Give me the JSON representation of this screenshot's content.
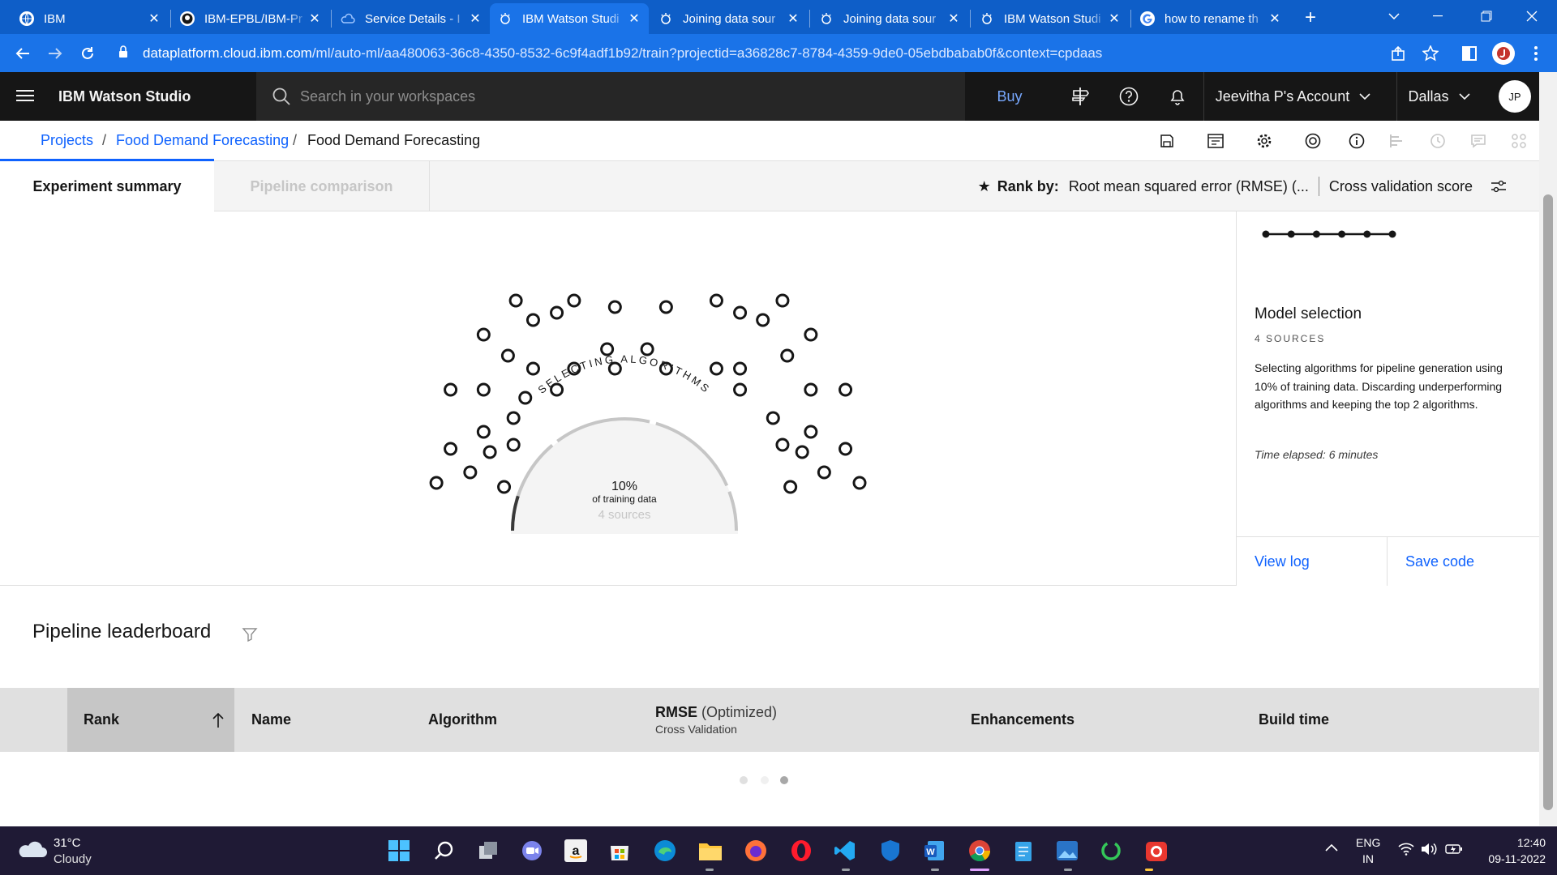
{
  "browser": {
    "tabs": [
      {
        "title": "IBM",
        "favicon": "globe-icon",
        "favicon_bg": "#ffffff"
      },
      {
        "title": "IBM-EPBL/IBM-Pr",
        "favicon": "github-icon",
        "favicon_bg": "#ffffff"
      },
      {
        "title": "Service Details - I",
        "favicon": "ibm-cloud-icon",
        "favicon_bg": "#0e5ec8"
      },
      {
        "title": "IBM Watson Studi",
        "favicon": "watson-icon",
        "favicon_bg": "#1a73e8"
      },
      {
        "title": "Joining data sour",
        "favicon": "watson-icon",
        "favicon_bg": "#0e5ec8"
      },
      {
        "title": "Joining data sour",
        "favicon": "watson-icon",
        "favicon_bg": "#0e5ec8"
      },
      {
        "title": "IBM Watson Studi",
        "favicon": "watson-icon",
        "favicon_bg": "#0e5ec8"
      },
      {
        "title": "how to rename th",
        "favicon": "google-icon",
        "favicon_bg": "#ffffff"
      }
    ],
    "new_tab": "+",
    "url_host": "dataplatform.cloud.ibm.com",
    "url_path": "/ml/auto-ml/aa480063-36c8-4350-8532-6c9f4adf1b92/train?projectid=a36828c7-8784-4359-9de0-05ebdbabab0f&context=cpdaas"
  },
  "header": {
    "app_name": "IBM Watson Studio",
    "search_placeholder": "Search in your workspaces",
    "buy": "Buy",
    "account": "Jeevitha P's Account",
    "region": "Dallas",
    "avatar_initials": "JP"
  },
  "breadcrumb": {
    "projects": "Projects",
    "project": "Food Demand Forecasting",
    "current": "Food Demand Forecasting",
    "separator": "/"
  },
  "tabs": {
    "summary": "Experiment summary",
    "comparison": "Pipeline comparison"
  },
  "rank": {
    "label": "Rank by:",
    "metric": "Root mean squared error (RMSE) (...",
    "score": "Cross validation score"
  },
  "progress": {
    "arc_label": "SELECTING ALGORITHMS",
    "percent": "10%",
    "percent_label": "of training data",
    "sources": "4 sources",
    "fill_fraction": 0.1
  },
  "stage_panel": {
    "title": "Model selection",
    "count": "4 SOURCES",
    "description": "Selecting algorithms for pipeline generation using 10% of training data. Discarding underperforming algorithms and keeping the top 2 algorithms.",
    "elapsed": "Time elapsed: 6 minutes",
    "view_log": "View log",
    "save_code": "Save code",
    "steps_total": 6
  },
  "leaderboard": {
    "title": "Pipeline leaderboard",
    "columns": {
      "rank": "Rank",
      "name": "Name",
      "algorithm": "Algorithm",
      "rmse": "RMSE",
      "rmse_suffix": "(Optimized)",
      "rmse_sub": "Cross Validation",
      "enhancements": "Enhancements",
      "build_time": "Build time"
    }
  },
  "taskbar": {
    "temperature": "31°C",
    "weather": "Cloudy",
    "lang": "ENG",
    "region": "IN",
    "time": "12:40",
    "date": "09-11-2022"
  },
  "colors": {
    "ibm_blue": "#0f62fe",
    "header_bg": "#161616",
    "chrome_blue": "#1a73e8"
  }
}
